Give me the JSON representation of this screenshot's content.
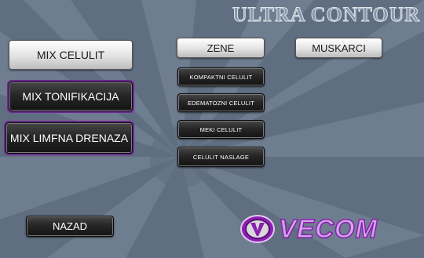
{
  "header": {
    "brand": "ULTRA CONTOUR"
  },
  "mix_buttons": {
    "celulit": "MIX CELULIT",
    "tonifikacija": "MIX TONIFIKACIJA",
    "limfna": "MIX LIMFNA DRENAZA"
  },
  "gender_tabs": {
    "zene": "ZENE",
    "muskarci": "MUSKARCI"
  },
  "program_buttons": [
    "KOMPAKTNI CELULIT",
    "EDEMATOZNI CELULIT",
    "MEKI CELULIT",
    "CELULIT NASLAGE"
  ],
  "nav": {
    "back": "NAZAD"
  },
  "footer": {
    "logo_text": "VECOM"
  },
  "colors": {
    "background": "#5f6e80",
    "accent_purple": "#8a1fb0",
    "button_dark": "#262626",
    "button_light": "#e3e3e3"
  }
}
